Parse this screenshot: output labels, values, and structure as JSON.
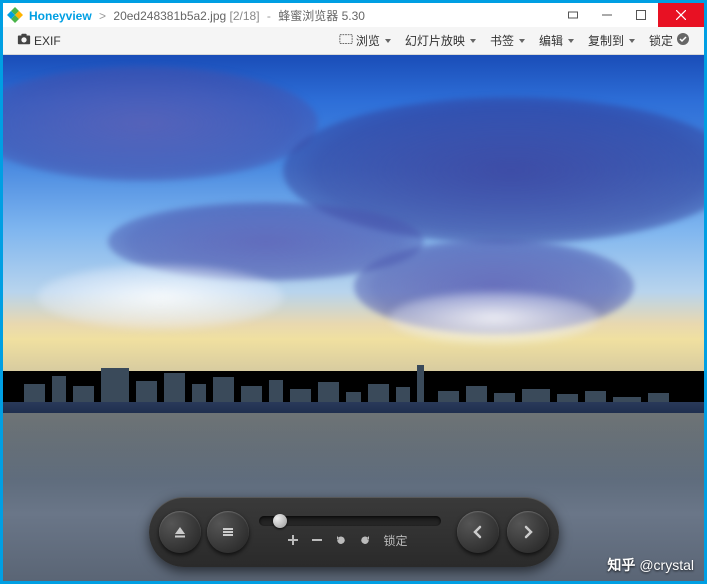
{
  "title": {
    "app": "Honeyview",
    "sep": ">",
    "file": "20ed248381b5a2.jpg",
    "count": "[2/18]",
    "dash": "-",
    "subtitle": "蜂蜜浏览器 5.30"
  },
  "toolbar": {
    "exif": "EXIF",
    "view": "浏览",
    "slideshow": "幻灯片放映",
    "bookmark": "书签",
    "edit": "编辑",
    "copyto": "复制到",
    "lock": "锁定"
  },
  "controls": {
    "lock": "锁定"
  },
  "watermark": {
    "brand": "知乎",
    "at": "@crystal"
  }
}
